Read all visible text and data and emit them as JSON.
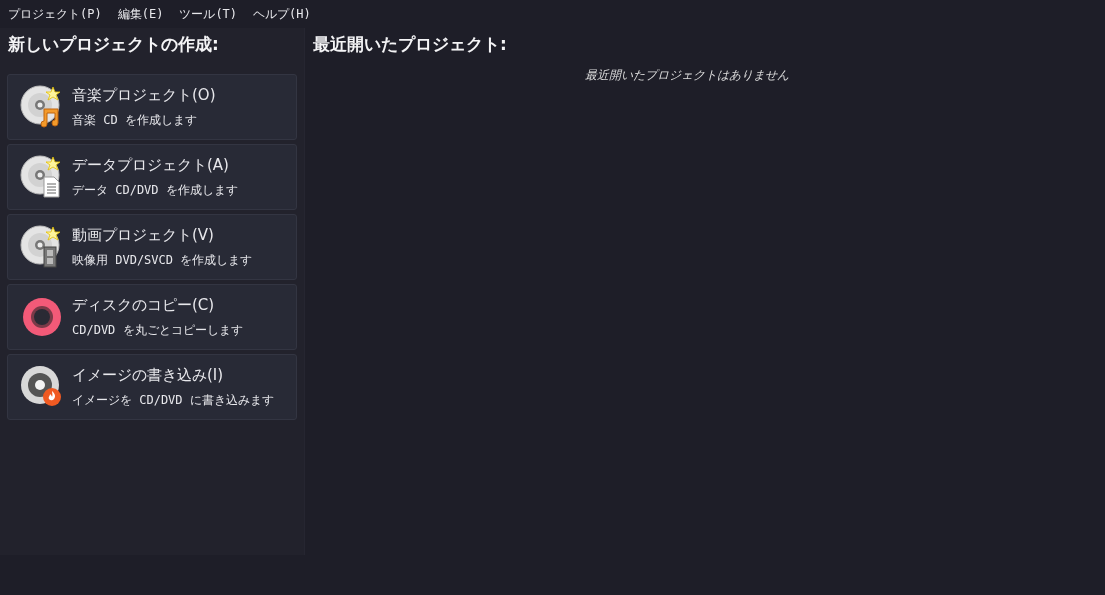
{
  "menu": [
    "プロジェクト(P)",
    "編集(E)",
    "ツール(T)",
    "ヘルプ(H)"
  ],
  "new_project": {
    "title": "新しいプロジェクトの作成:",
    "items": [
      {
        "kind": "music",
        "title": "音楽プロジェクト(O)",
        "description": "音楽 CD を作成します"
      },
      {
        "kind": "data",
        "title": "データプロジェクト(A)",
        "description": "データ CD/DVD を作成します"
      },
      {
        "kind": "video",
        "title": "動画プロジェクト(V)",
        "description": "映像用 DVD/SVCD を作成します"
      },
      {
        "kind": "copy",
        "title": "ディスクのコピー(C)",
        "description": "CD/DVD を丸ごとコピーします"
      },
      {
        "kind": "burn",
        "title": "イメージの書き込み(I)",
        "description": "イメージを CD/DVD に書き込みます"
      }
    ]
  },
  "recent": {
    "title": "最近開いたプロジェクト:",
    "empty_message": "最近開いたプロジェクトはありません"
  }
}
